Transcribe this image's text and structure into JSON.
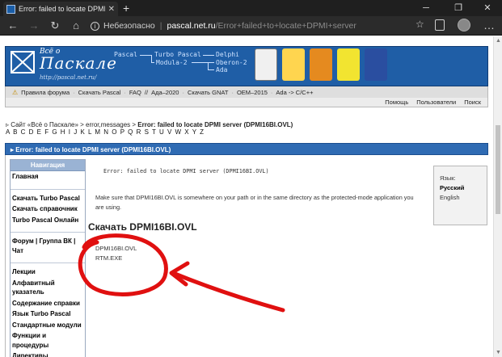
{
  "browser": {
    "tab_title": "Error: failed to locate DPMI serv",
    "close_tab": "✕",
    "new_tab": "+",
    "minimize": "─",
    "maximize": "❐",
    "close_window": "✕",
    "security_label": "Небезопасно",
    "address_host": "pascal.net.ru",
    "address_path": "/Error+failed+to+locate+DPMI+server"
  },
  "banner": {
    "logo_top": "Всё о",
    "logo_main": "Паскале",
    "logo_url": "http://pascal.net.ru/",
    "tree": {
      "pascal": "Pascal",
      "turbo": "Turbo Pascal",
      "modula": "Modula-2",
      "delphi": "Delphi",
      "oberon": "Oberon-2",
      "ada": "Ada"
    }
  },
  "toolbar": {
    "items": [
      "Правила форума",
      "Скачать Pascal",
      "FAQ",
      "//",
      "Ада–2020",
      "Скачать GNAT",
      "OEM–2015",
      "Ada -> C/C++"
    ],
    "right_items": [
      "Помощь",
      "Пользователи",
      "Поиск"
    ]
  },
  "breadcrumb": {
    "prefix": "▹ Сайт «Всё о Паскале» > error,messages > ",
    "current": "Error: failed to locate DPMI server (DPMI16BI.OVL)"
  },
  "alphabet": "A B C D E F G H I J K L M N O P Q R S T U V W X Y Z",
  "page_title": "▸ Error: failed to locate DPMI server (DPMI16BI.OVL)",
  "sidenav": {
    "heading": "Навигация",
    "groups": [
      [
        "Главная"
      ],
      [
        "Скачать Turbo Pascal",
        "Скачать справочник",
        "Turbo Pascal Онлайн"
      ],
      [
        "Форум | Группа ВК | Чат"
      ],
      [
        "Лекции",
        "Алфавитный указатель",
        "Содержание справки",
        "Язык Turbo Pascal",
        "Стандартные модули",
        "Функции и процедуры",
        "Директивы"
      ]
    ]
  },
  "main": {
    "error_message": "Error: failed to locate DPMI server (DPMI16BI.OVL)",
    "description": "Make sure that DPMI16BI.OVL is somewhere on your path or in the same directory as the protected-mode application you are using.",
    "download_heading": "Скачать DPMI16BI.OVL",
    "files": [
      "DPMI16BI.OVL",
      "RTM.EXE"
    ]
  },
  "language": {
    "label": "Язык:",
    "current": "Русский",
    "alternative": "English"
  },
  "colors": {
    "banner": "#1f5ea6",
    "title_bar": "#2f6bb3",
    "annotation": "#e01010"
  }
}
